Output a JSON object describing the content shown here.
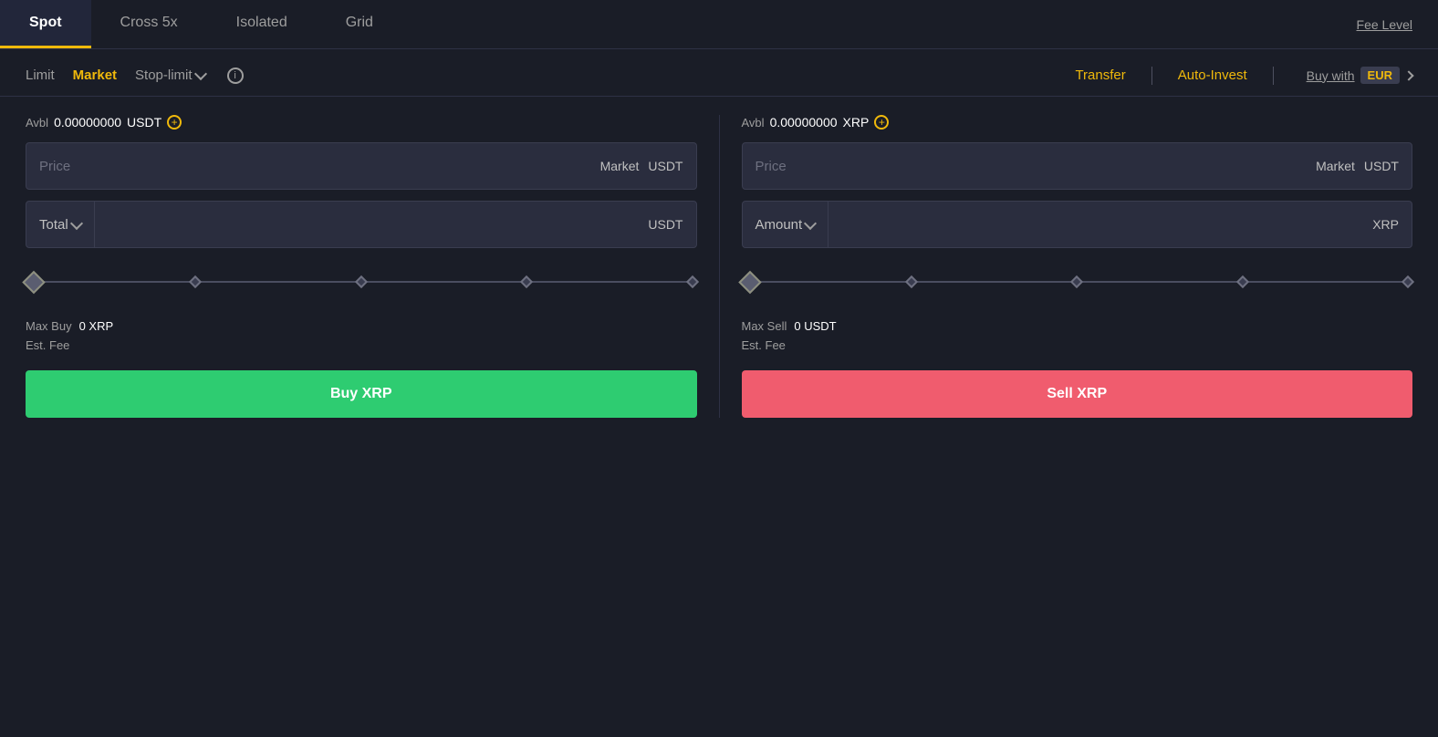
{
  "tabs": {
    "spot": "Spot",
    "cross5x": "Cross 5x",
    "isolated": "Isolated",
    "grid": "Grid",
    "fee_level": "Fee Level"
  },
  "order_types": {
    "limit": "Limit",
    "market": "Market",
    "stop_limit": "Stop-limit"
  },
  "toolbar": {
    "transfer": "Transfer",
    "auto_invest": "Auto-Invest",
    "buy_with": "Buy with",
    "buy_with_currency": "EUR"
  },
  "buy_panel": {
    "avbl_label": "Avbl",
    "avbl_value": "0.00000000",
    "avbl_currency": "USDT",
    "price_placeholder": "Price",
    "price_suffix_market": "Market",
    "price_suffix_currency": "USDT",
    "total_label": "Total",
    "total_currency": "USDT",
    "max_buy_label": "Max Buy",
    "max_buy_value": "0 XRP",
    "est_fee_label": "Est. Fee",
    "buy_btn_label": "Buy XRP"
  },
  "sell_panel": {
    "avbl_label": "Avbl",
    "avbl_value": "0.00000000",
    "avbl_currency": "XRP",
    "price_placeholder": "Price",
    "price_suffix_market": "Market",
    "price_suffix_currency": "USDT",
    "amount_label": "Amount",
    "amount_currency": "XRP",
    "max_sell_label": "Max Sell",
    "max_sell_value": "0 USDT",
    "est_fee_label": "Est. Fee",
    "sell_btn_label": "Sell XRP"
  },
  "colors": {
    "active_tab_indicator": "#f0b90b",
    "active_order_type": "#f0b90b",
    "buy_btn": "#2ecc71",
    "sell_btn": "#f05c6e",
    "transfer": "#f0b90b",
    "auto_invest": "#f0b90b"
  }
}
